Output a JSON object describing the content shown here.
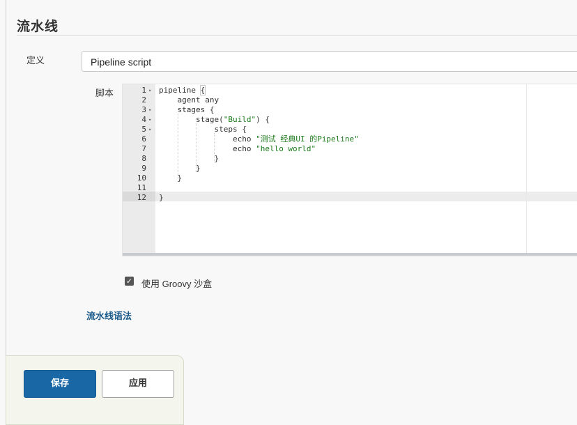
{
  "section": {
    "title": "流水线"
  },
  "definition": {
    "label": "定义",
    "selected": "Pipeline script"
  },
  "script": {
    "label": "脚本",
    "lines": [
      {
        "n": "1",
        "fold": "▾",
        "code": "pipeline {"
      },
      {
        "n": "2",
        "fold": "",
        "code": "    agent any"
      },
      {
        "n": "3",
        "fold": "▾",
        "code": "    stages {"
      },
      {
        "n": "4",
        "fold": "▾",
        "code": "        stage(\"Build\") {"
      },
      {
        "n": "5",
        "fold": "▾",
        "code": "            steps {"
      },
      {
        "n": "6",
        "fold": "",
        "code": "                echo \"测试 经典UI 的Pipeline\""
      },
      {
        "n": "7",
        "fold": "",
        "code": "                echo \"hello world\""
      },
      {
        "n": "8",
        "fold": "",
        "code": "            }"
      },
      {
        "n": "9",
        "fold": "",
        "code": "        }"
      },
      {
        "n": "10",
        "fold": "",
        "code": "    }"
      },
      {
        "n": "11",
        "fold": "",
        "code": ""
      },
      {
        "n": "12",
        "fold": "",
        "code": "}"
      }
    ],
    "active_line": "12"
  },
  "sandbox": {
    "checked": true,
    "label": "使用 Groovy 沙盒"
  },
  "syntax_link": "流水线语法",
  "buttons": {
    "save": "保存",
    "apply": "应用"
  },
  "colors": {
    "primary": "#1a67a6",
    "link": "#1a5a8a",
    "string": "#1a7a1a"
  }
}
